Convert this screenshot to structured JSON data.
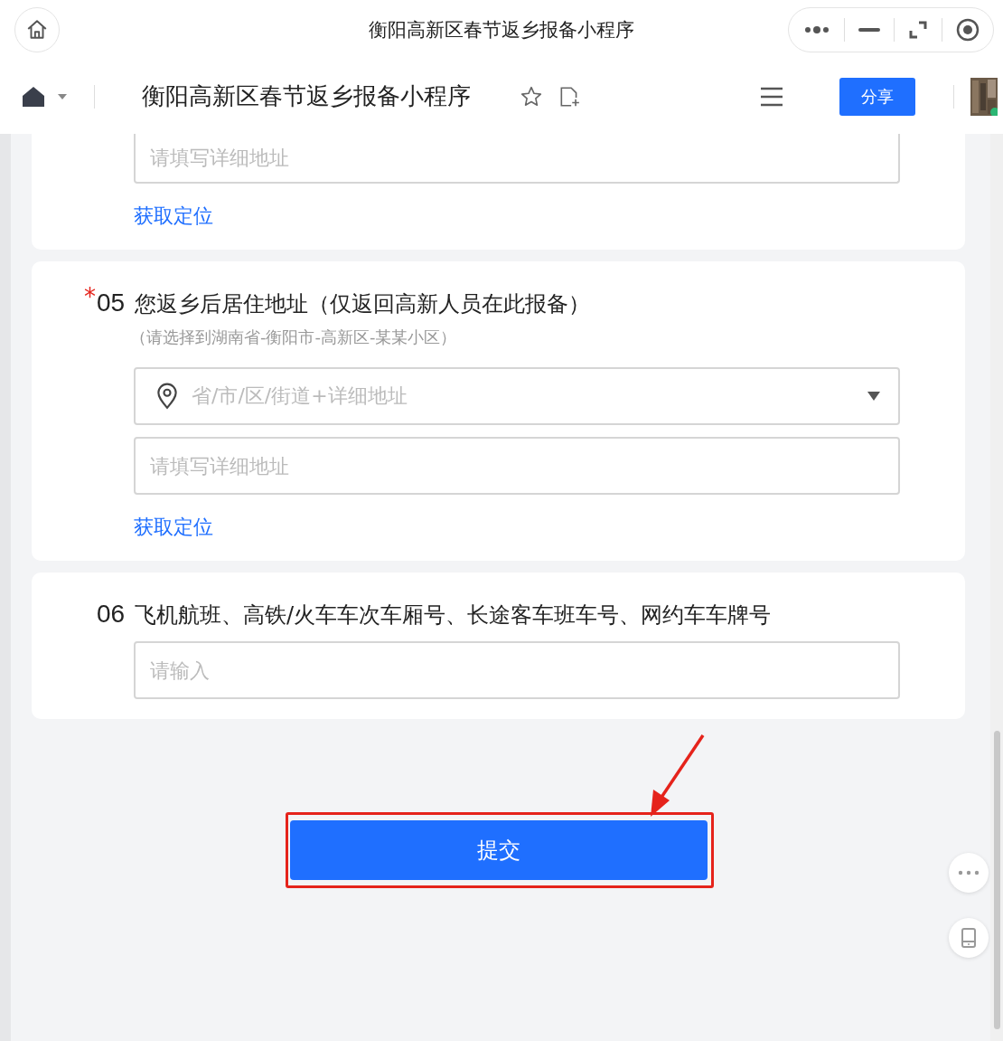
{
  "window": {
    "title": "衡阳高新区春节返乡报备小程序"
  },
  "toolbar": {
    "title": "衡阳高新区春节返乡报备小程序",
    "share_button": "分享"
  },
  "sections": [
    {
      "kind": "partial",
      "fields": [
        {
          "kind": "text",
          "placeholder": "请填写详细地址"
        }
      ],
      "link": "获取定位"
    },
    {
      "kind": "question",
      "required_mark": "*",
      "number": "05",
      "label": "您返乡后居住地址（仅返回高新人员在此报备）",
      "hint": "（请选择到湖南省-衡阳市-高新区-某某小区）",
      "fields": [
        {
          "kind": "select",
          "placeholder": "省/市/区/街道+详细地址"
        },
        {
          "kind": "text",
          "placeholder": "请填写详细地址"
        }
      ],
      "link": "获取定位"
    },
    {
      "kind": "question",
      "number": "06",
      "label": "飞机航班、高铁/火车车次车厢号、长途客车班车号、网约车车牌号",
      "fields": [
        {
          "kind": "text",
          "placeholder": "请输入"
        }
      ]
    }
  ],
  "submit_button": "提交"
}
